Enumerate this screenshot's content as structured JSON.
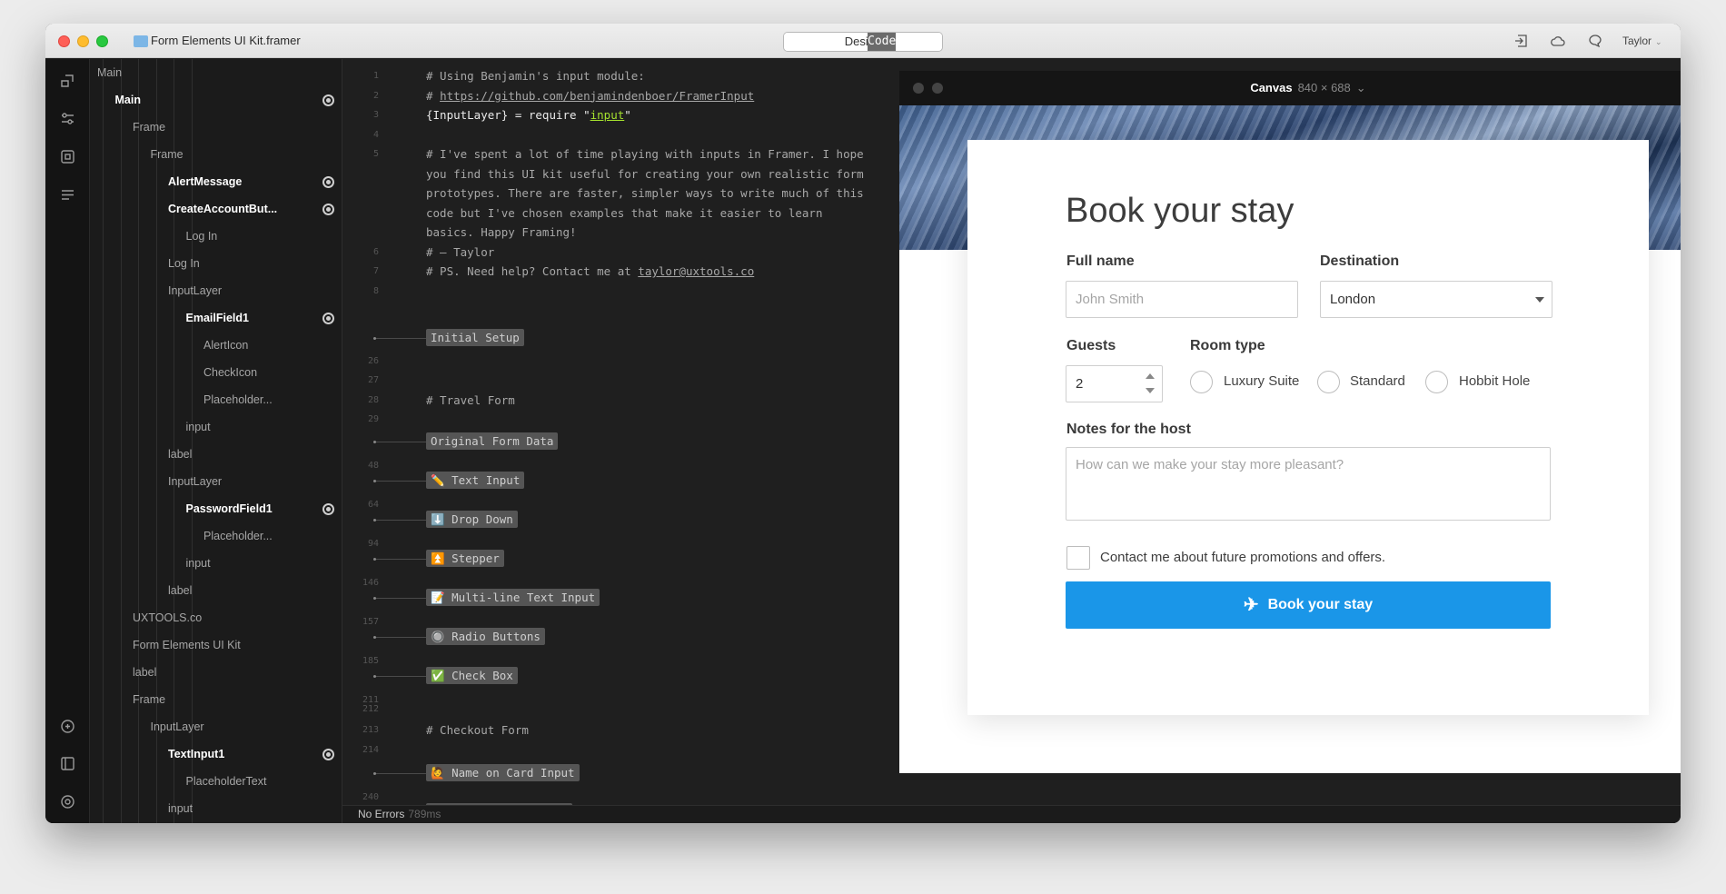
{
  "window": {
    "title": "Form Elements UI Kit.framer",
    "mode_design": "Design",
    "mode_code": "Code",
    "user": "Taylor"
  },
  "layers": [
    {
      "label": "Main",
      "depth": 0,
      "bold": false,
      "dot": false
    },
    {
      "label": "Main",
      "depth": 1,
      "bold": true,
      "dot": true
    },
    {
      "label": "Frame",
      "depth": 2,
      "bold": false,
      "dot": false
    },
    {
      "label": "Frame",
      "depth": 3,
      "bold": false,
      "dot": false
    },
    {
      "label": "AlertMessage",
      "depth": 4,
      "bold": true,
      "dot": true
    },
    {
      "label": "CreateAccountBut...",
      "depth": 4,
      "bold": true,
      "dot": true
    },
    {
      "label": "Log In",
      "depth": 5,
      "bold": false,
      "dot": false
    },
    {
      "label": "Log In",
      "depth": 4,
      "bold": false,
      "dot": false
    },
    {
      "label": "InputLayer",
      "depth": 4,
      "bold": false,
      "dot": false
    },
    {
      "label": "EmailField1",
      "depth": 5,
      "bold": true,
      "dot": true
    },
    {
      "label": "AlertIcon",
      "depth": 6,
      "bold": false,
      "dot": false
    },
    {
      "label": "CheckIcon",
      "depth": 6,
      "bold": false,
      "dot": false
    },
    {
      "label": "Placeholder...",
      "depth": 6,
      "bold": false,
      "dot": false
    },
    {
      "label": "input",
      "depth": 5,
      "bold": false,
      "dot": false
    },
    {
      "label": "label",
      "depth": 4,
      "bold": false,
      "dot": false
    },
    {
      "label": "InputLayer",
      "depth": 4,
      "bold": false,
      "dot": false
    },
    {
      "label": "PasswordField1",
      "depth": 5,
      "bold": true,
      "dot": true
    },
    {
      "label": "Placeholder...",
      "depth": 6,
      "bold": false,
      "dot": false
    },
    {
      "label": "input",
      "depth": 5,
      "bold": false,
      "dot": false
    },
    {
      "label": "label",
      "depth": 4,
      "bold": false,
      "dot": false
    },
    {
      "label": "UXTOOLS.co",
      "depth": 2,
      "bold": false,
      "dot": false
    },
    {
      "label": "Form Elements UI Kit",
      "depth": 2,
      "bold": false,
      "dot": false
    },
    {
      "label": "label",
      "depth": 2,
      "bold": false,
      "dot": false
    },
    {
      "label": "Frame",
      "depth": 2,
      "bold": false,
      "dot": false
    },
    {
      "label": "InputLayer",
      "depth": 3,
      "bold": false,
      "dot": false
    },
    {
      "label": "TextInput1",
      "depth": 4,
      "bold": true,
      "dot": true
    },
    {
      "label": "PlaceholderText",
      "depth": 5,
      "bold": false,
      "dot": false
    },
    {
      "label": "input",
      "depth": 4,
      "bold": false,
      "dot": false
    }
  ],
  "editor": {
    "lines": [
      {
        "num": "1",
        "text": "# Using Benjamin's input module:"
      },
      {
        "num": "2",
        "prefix": "# ",
        "link": "https://github.com/benjamindenboer/FramerInput"
      },
      {
        "num": "3",
        "text": "{InputLayer} = require \"",
        "str": "input",
        "suffix": "\""
      },
      {
        "num": "4",
        "text": ""
      },
      {
        "num": "5",
        "text": "# I've spent a lot of time playing with inputs in Framer. I hope"
      },
      {
        "num": "",
        "text": "you find this UI kit useful for creating your own realistic form"
      },
      {
        "num": "",
        "text": "prototypes. There are faster, simpler ways to write much of this"
      },
      {
        "num": "",
        "text": "code but I've chosen examples that make it easier to learn"
      },
      {
        "num": "",
        "text": "basics. Happy Framing!"
      },
      {
        "num": "6",
        "text": "# — Taylor"
      },
      {
        "num": "7",
        "prefix": "# PS. Need help? Contact me at ",
        "link": "taylor@uxtools.co"
      },
      {
        "num": "8",
        "text": ""
      }
    ],
    "folds": [
      {
        "label": "Initial Setup",
        "after": "26"
      },
      {
        "label": "Original Form Data",
        "after": "48"
      },
      {
        "label": "✏️ Text Input",
        "after": "64"
      },
      {
        "label": "⬇️ Drop Down",
        "after": "94"
      },
      {
        "label": "⏫ Stepper",
        "after": "146"
      },
      {
        "label": "📝 Multi-line Text Input",
        "after": "157"
      },
      {
        "label": "🔘 Radio Buttons",
        "after": "185"
      },
      {
        "label": "✅ Check Box",
        "after": "211"
      },
      {
        "label": "🙋 Name on Card Input",
        "after": "240"
      },
      {
        "label": "💳 Credit Card Input",
        "after": ""
      }
    ],
    "misc": {
      "n27": "27",
      "n28": "28",
      "travel": "# Travel Form",
      "n29": "29",
      "n212": "212",
      "n213": "213",
      "checkout": "# Checkout Form",
      "n214": "214"
    }
  },
  "status": {
    "text": "No Errors",
    "ms": "789ms"
  },
  "canvas": {
    "title": "Canvas",
    "size": "840 × 688"
  },
  "form": {
    "title": "Book your stay",
    "fullname_label": "Full name",
    "fullname_placeholder": "John Smith",
    "destination_label": "Destination",
    "destination_value": "London",
    "guests_label": "Guests",
    "guests_value": "2",
    "roomtype_label": "Room type",
    "room_options": [
      "Luxury Suite",
      "Standard",
      "Hobbit Hole"
    ],
    "notes_label": "Notes for the host",
    "notes_placeholder": "How can we make your stay more pleasant?",
    "promo_label": "Contact me about future promotions and offers.",
    "submit_label": "Book your stay",
    "accent": "#1a96e8"
  }
}
